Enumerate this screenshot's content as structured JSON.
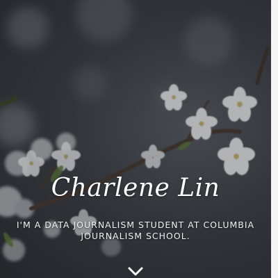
{
  "hero": {
    "name": "Charlene Lin",
    "tagline": "I'M A DATA JOURNALISM STUDENT AT COLUMBIA JOURNALISM SCHOOL."
  },
  "icons": {
    "scroll_down": "chevron-down-icon"
  },
  "colors": {
    "background": "#3d4147",
    "blossom": "#eef0f2",
    "branch": "#4a3a30",
    "text": "#ffffff"
  }
}
